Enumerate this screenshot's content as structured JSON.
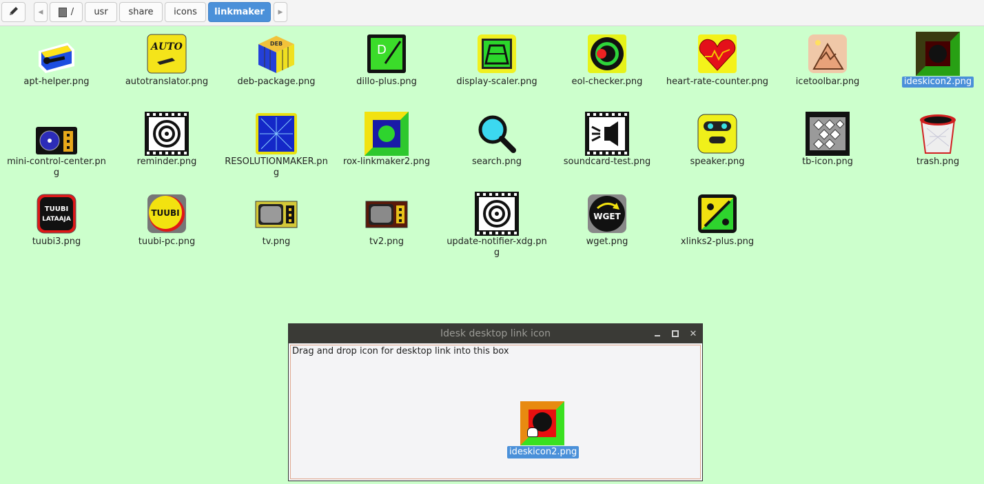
{
  "toolbar": {
    "edit_icon": "pencil-icon",
    "back_icon": "chevron-left-icon",
    "forward_icon": "chevron-right-icon",
    "root_icon": "drive-icon",
    "crumbs": [
      "/",
      "usr",
      "share",
      "icons",
      "linkmaker"
    ],
    "active_crumb": "linkmaker"
  },
  "files": [
    {
      "name": "apt-helper.png",
      "icon": "apt-helper-icon"
    },
    {
      "name": "autotranslator.png",
      "icon": "auto-icon"
    },
    {
      "name": "deb-package.png",
      "icon": "deb-cube-icon"
    },
    {
      "name": "dillo-plus.png",
      "icon": "dillo-icon"
    },
    {
      "name": "display-scaler.png",
      "icon": "display-scaler-icon"
    },
    {
      "name": "eol-checker.png",
      "icon": "target-icon"
    },
    {
      "name": "heart-rate-counter.png",
      "icon": "heart-icon"
    },
    {
      "name": "icetoolbar.png",
      "icon": "mountain-icon"
    },
    {
      "name": "ideskicon2.png",
      "icon": "ideskicon-icon",
      "selected": true
    },
    {
      "name": "mini-control-center.png",
      "icon": "control-center-icon"
    },
    {
      "name": "reminder.png",
      "icon": "filmstrip-spiral-icon"
    },
    {
      "name": "RESOLUTIONMAKER.png",
      "icon": "resolution-icon"
    },
    {
      "name": "rox-linkmaker2.png",
      "icon": "linkmaker-icon"
    },
    {
      "name": "search.png",
      "icon": "magnifier-icon"
    },
    {
      "name": "soundcard-test.png",
      "icon": "speaker-film-icon"
    },
    {
      "name": "speaker.png",
      "icon": "robot-face-icon"
    },
    {
      "name": "tb-icon.png",
      "icon": "tb-pattern-icon"
    },
    {
      "name": "trash.png",
      "icon": "trash-icon"
    },
    {
      "name": "tuubi3.png",
      "icon": "tuubi-lataaja-icon"
    },
    {
      "name": "tuubi-pc.png",
      "icon": "tuubi-icon"
    },
    {
      "name": "tv.png",
      "icon": "tv-icon"
    },
    {
      "name": "tv2.png",
      "icon": "tv2-icon"
    },
    {
      "name": "update-notifier-xdg.png",
      "icon": "filmstrip-spiral-icon"
    },
    {
      "name": "wget.png",
      "icon": "wget-icon"
    },
    {
      "name": "xlinks2-plus.png",
      "icon": "xlinks-icon"
    }
  ],
  "icon_text": {
    "auto": "AUTO",
    "deb": "DEB",
    "tuubi": "TUUBI",
    "lataaja": "LATAAJA",
    "wget": "WGET"
  },
  "dialog": {
    "title": "Idesk desktop link icon",
    "minimize_icon": "minimize-icon",
    "maximize_icon": "maximize-icon",
    "close_icon": "close-icon",
    "instruction": "Drag and drop icon for desktop link into this box",
    "dropped_name": "ideskicon2.png",
    "cursor_icon": "grab-hand-icon"
  },
  "colors": {
    "background": "#ccffcc",
    "selection": "#4a90d9",
    "titlebar": "#3a3a36"
  }
}
